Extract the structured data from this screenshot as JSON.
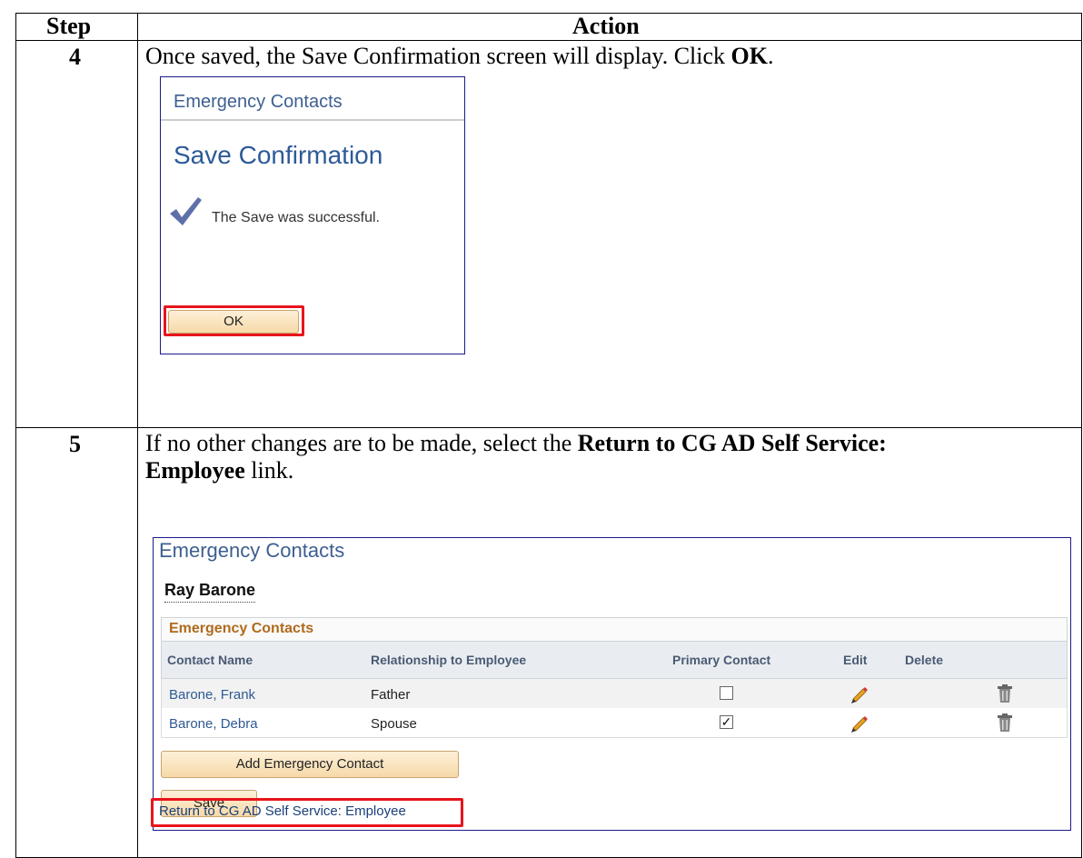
{
  "table": {
    "header_step": "Step",
    "header_action": "Action"
  },
  "step4": {
    "number": "4",
    "instruction_pre": "Once saved, the Save Confirmation screen will display. Click ",
    "instruction_bold": "OK",
    "instruction_post": ".",
    "screen": {
      "page_title": "Emergency Contacts",
      "confirm_title": "Save Confirmation",
      "message": "The Save was successful.",
      "ok_label": "OK",
      "check_icon": "checkmark-icon"
    }
  },
  "step5": {
    "number": "5",
    "instruction_pre": "If no other changes are to be made, select the ",
    "instruction_bold_1": "Return to CG AD Self Service:",
    "instruction_bold_2": "Employee",
    "instruction_post": " link.",
    "screen": {
      "page_title": "Emergency Contacts",
      "person_name": "Ray Barone",
      "grid_caption": "Emergency Contacts",
      "columns": [
        "Contact Name",
        "Relationship to Employee",
        "Primary Contact",
        "Edit",
        "Delete"
      ],
      "rows": [
        {
          "contact_name": "Barone, Frank",
          "relationship": "Father",
          "primary": false
        },
        {
          "contact_name": "Barone, Debra",
          "relationship": "Spouse",
          "primary": true
        }
      ],
      "add_label": "Add Emergency Contact",
      "save_label": "Save",
      "return_link": "Return to CG AD Self Service: Employee"
    }
  },
  "colors": {
    "highlight": "#e8141c",
    "title_blue": "#3d5f90",
    "caption_orange": "#b06a1d",
    "button_fill": "#f6d9a8"
  }
}
